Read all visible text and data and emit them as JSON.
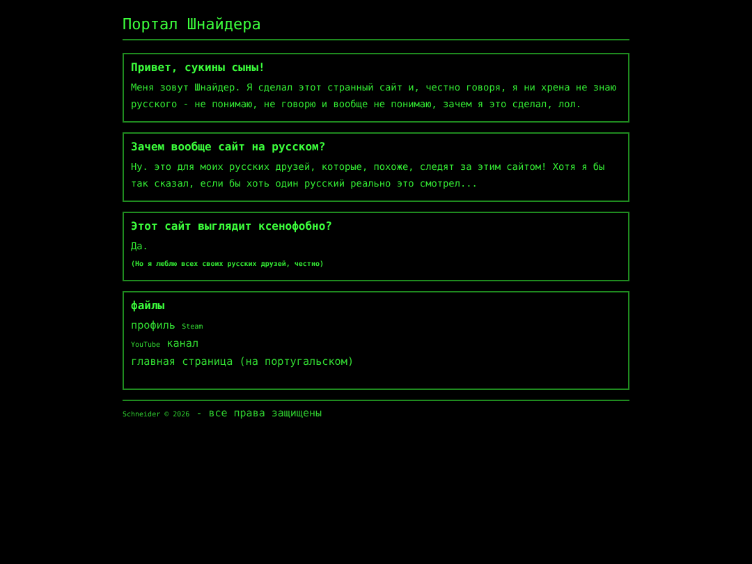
{
  "header": {
    "title": "Портал Шнайдера"
  },
  "sections": [
    {
      "kind": "text",
      "heading": "Привет, сукины сыны!",
      "paragraphs": [
        {
          "text": "Меня зовут Шнайдер. Я сделал этот странный сайт и, честно говоря, я ни хрена не знаю русского - не понимаю, не говорю и вообще не понимаю, зачем я это сделал, лол.",
          "small": false
        }
      ]
    },
    {
      "kind": "text",
      "heading": "Зачем вообще сайт на русском?",
      "paragraphs": [
        {
          "text": "Ну. это для моих русских друзей, которые, похоже, следят за этим сайтом! Хотя я бы так сказал, если бы хоть один русский реально это смотрел...",
          "small": false
        }
      ]
    },
    {
      "kind": "text",
      "heading": "Этот сайт выглядит ксенофобно?",
      "paragraphs": [
        {
          "text": "Да.",
          "small": false
        },
        {
          "text": "(Но я люблю всех своих русских друзей, честно)",
          "small": true
        }
      ]
    },
    {
      "kind": "links",
      "heading": "файлы",
      "links": [
        {
          "parts": [
            {
              "text": "профиль",
              "small": false
            },
            {
              "text": "Steam",
              "small": true
            }
          ]
        },
        {
          "parts": [
            {
              "text": "YouTube",
              "small": true
            },
            {
              "text": "канал",
              "small": false
            }
          ]
        },
        {
          "parts": [
            {
              "text": "главная страница (на португальском)",
              "small": false
            }
          ]
        }
      ]
    }
  ],
  "footer": {
    "parts": [
      {
        "text": "Schneider © 2026",
        "small": true
      },
      {
        "text": "- все права защищены",
        "small": false
      }
    ]
  }
}
